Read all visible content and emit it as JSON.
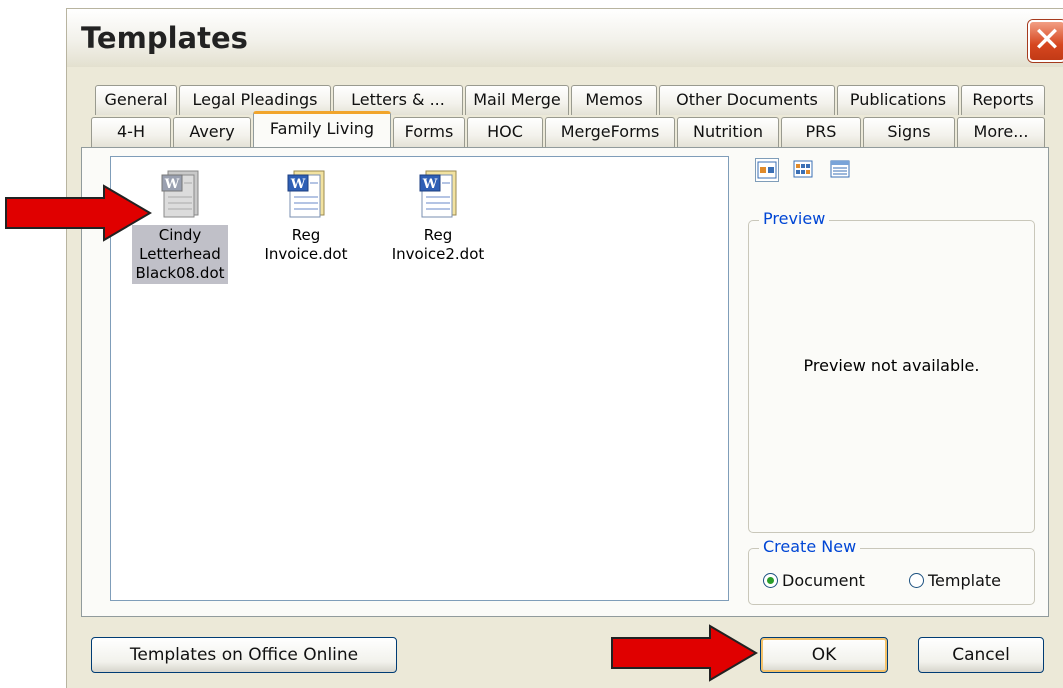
{
  "dialog": {
    "title": "Templates",
    "close_glyph": "✕"
  },
  "tabs_row1": [
    "General",
    "Legal Pleadings",
    "Letters & ...",
    "Mail Merge",
    "Memos",
    "Other Documents",
    "Publications",
    "Reports"
  ],
  "tabs_row2": [
    "4-H",
    "Avery",
    "Family Living",
    "Forms",
    "HOC",
    "MergeForms",
    "Nutrition",
    "PRS",
    "Signs",
    "More..."
  ],
  "active_tab": "Family Living",
  "files": [
    {
      "label": "Cindy Letterhead Black08.dot",
      "lines": [
        "Cindy",
        "Letterhead",
        "Black08.dot"
      ],
      "selected": true
    },
    {
      "label": "Reg Invoice.dot",
      "lines": [
        "Reg",
        "Invoice.dot"
      ],
      "selected": false
    },
    {
      "label": "Reg Invoice2.dot",
      "lines": [
        "Reg",
        "Invoice2.dot"
      ],
      "selected": false
    }
  ],
  "view_buttons": [
    "large-icons-view-icon",
    "list-view-icon",
    "details-view-icon"
  ],
  "preview": {
    "legend": "Preview",
    "message": "Preview not available."
  },
  "create_new": {
    "legend": "Create New",
    "document_label": "Document",
    "template_label": "Template",
    "selected": "Document"
  },
  "buttons": {
    "online": "Templates on Office Online",
    "ok": "OK",
    "cancel": "Cancel"
  },
  "colors": {
    "arrow": "#e00000",
    "accent_tab": "#f1a52c",
    "legend_text": "#0046d5",
    "close": "#d6461f"
  }
}
